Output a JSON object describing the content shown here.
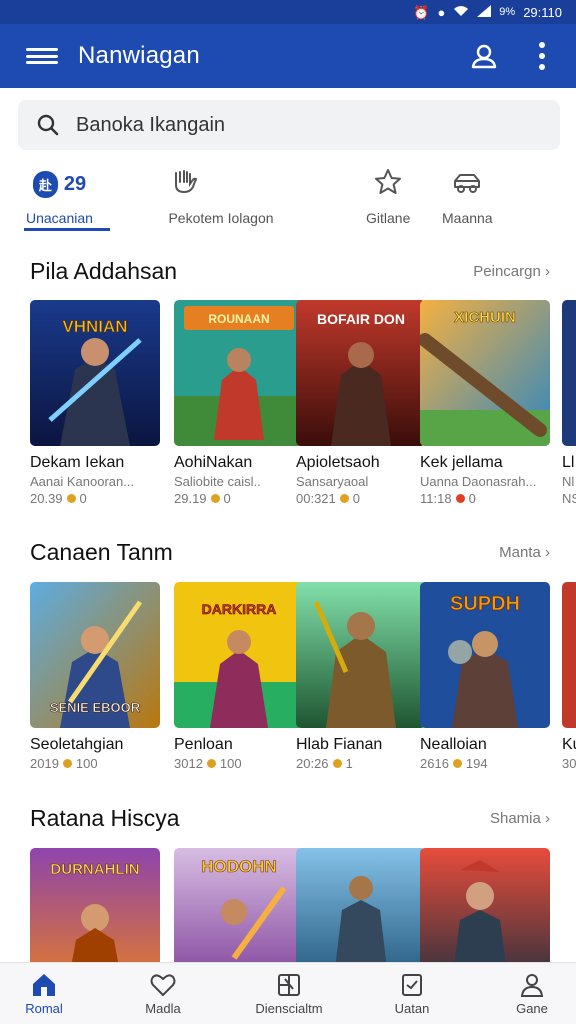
{
  "status_bar": {
    "battery": "9%",
    "time": "29:110"
  },
  "app_bar": {
    "title": "Nanwiagan"
  },
  "search": {
    "placeholder": "Banoka Ikangain"
  },
  "categories": [
    {
      "badge": "赴",
      "count": "29",
      "label": "Unacanian",
      "active": true
    },
    {
      "label": "Pekotem Iolagon"
    },
    {
      "label": "Gitlane"
    },
    {
      "label": "Maanna"
    }
  ],
  "sections": [
    {
      "title": "Pila Addahsan",
      "more": "Peincargn",
      "items": [
        {
          "thumb_text": "VHNIAN",
          "title": "Dekam Iekan",
          "sub": "Aanai Kanooran...",
          "time": "20.39",
          "count": "0"
        },
        {
          "thumb_text": "ROUNAAN",
          "title": "AohiNakan",
          "sub": "Saliobite caisl..",
          "time": "29.19",
          "count": "0"
        },
        {
          "thumb_text": "BOFAIR DON",
          "title": "Apioletsaoh",
          "sub": "Sansaryaoal",
          "time": "00:321",
          "count": "0"
        },
        {
          "thumb_text": "XICHUIN",
          "title": "Kek jellama",
          "sub": "Uanna Daonasrah...",
          "time": "11:18",
          "count": "0"
        },
        {
          "thumb_text": "",
          "title": "Ll",
          "sub": "Nl",
          "time": "NS",
          "count": ""
        }
      ]
    },
    {
      "title": "Canaen Tanm",
      "more": "Manta",
      "items": [
        {
          "thumb_text": "SENIE EBOOR",
          "title": "Seoletahgian",
          "sub": "",
          "time": "2019",
          "count": "100"
        },
        {
          "thumb_text": "DARKIRRA",
          "title": "Penloan",
          "sub": "",
          "time": "3012",
          "count": "100"
        },
        {
          "thumb_text": "",
          "title": "Hlab Fianan",
          "sub": "",
          "time": "20:26",
          "count": "1"
        },
        {
          "thumb_text": "SUPDH",
          "title": "Nealloian",
          "sub": "",
          "time": "2616",
          "count": "194"
        },
        {
          "thumb_text": "",
          "title": "Ku",
          "sub": "",
          "time": "30",
          "count": ""
        }
      ]
    },
    {
      "title": "Ratana Hiscya",
      "more": "Shamia",
      "items": [
        {
          "thumb_text": "DURNAHLIN",
          "title": "",
          "sub": "",
          "time": "",
          "count": ""
        },
        {
          "thumb_text": "HODOHN",
          "title": "",
          "sub": "",
          "time": "",
          "count": ""
        },
        {
          "thumb_text": "",
          "title": "",
          "sub": "",
          "time": "",
          "count": ""
        },
        {
          "thumb_text": "",
          "title": "",
          "sub": "",
          "time": "",
          "count": ""
        }
      ]
    }
  ],
  "bottom_nav": [
    {
      "label": "Romal",
      "icon": "home-icon",
      "active": true
    },
    {
      "label": "Madla",
      "icon": "heart-icon"
    },
    {
      "label": "Dienscialtm",
      "icon": "puzzle-icon"
    },
    {
      "label": "Uatan",
      "icon": "tablet-icon"
    },
    {
      "label": "Gane",
      "icon": "person-icon"
    }
  ],
  "colors": {
    "primary": "#1e4bb1",
    "status_bar": "#1a3f9a",
    "coin": "#e0a020",
    "coin_red": "#e04020"
  }
}
